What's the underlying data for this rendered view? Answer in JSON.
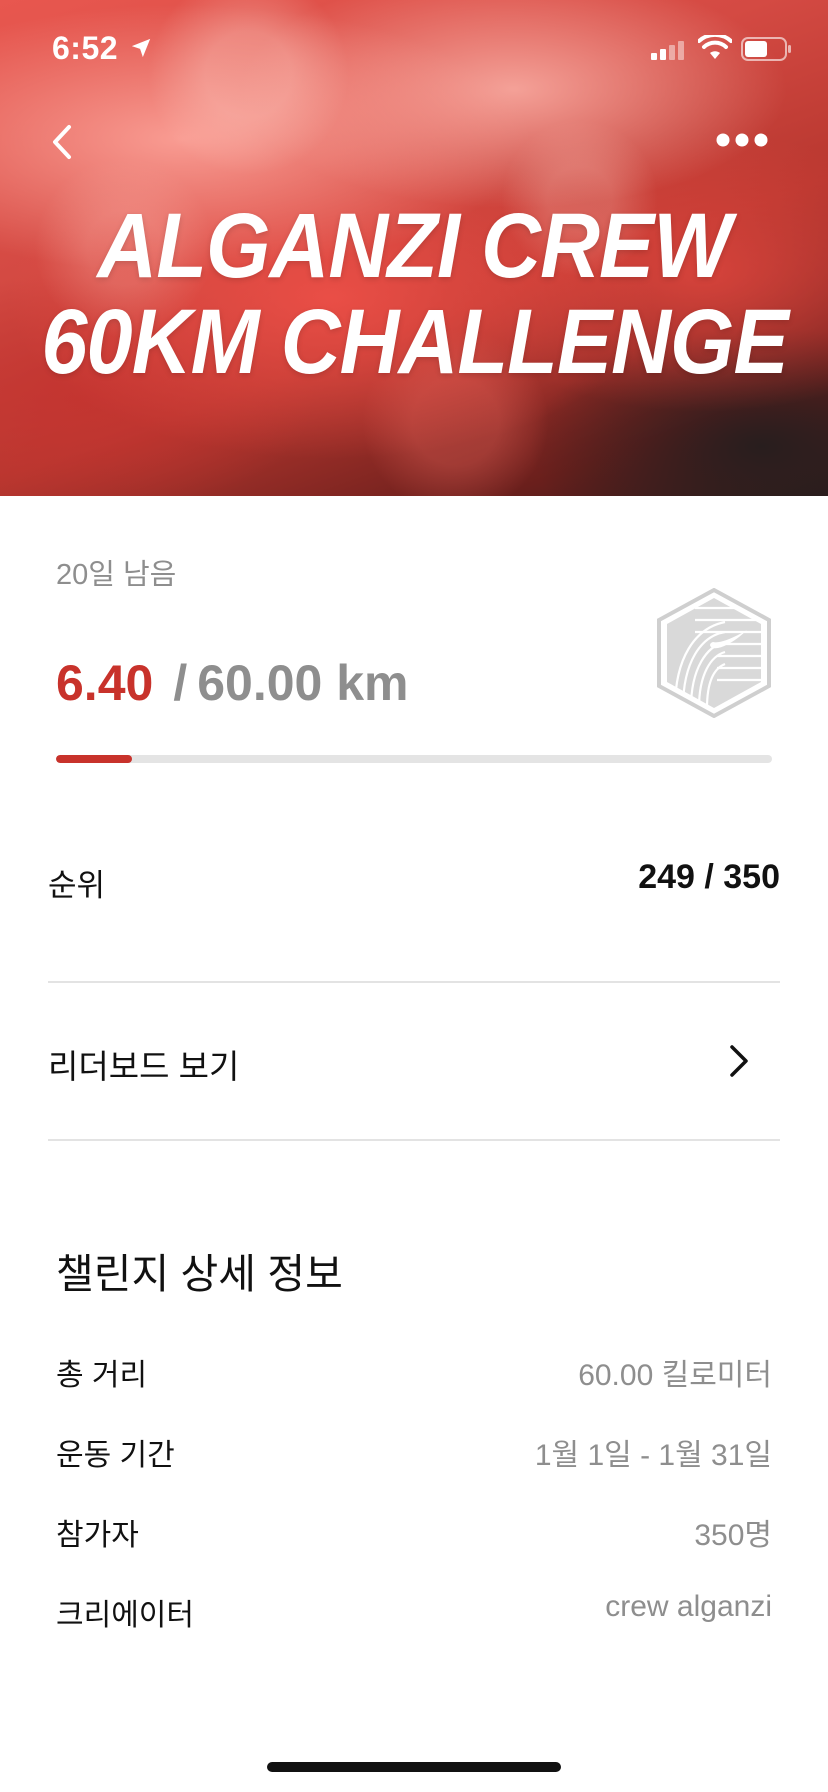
{
  "status_bar": {
    "time": "6:52"
  },
  "hero": {
    "title_line1": "ALGANZI CREW",
    "title_line2": "60KM CHALLENGE"
  },
  "challenge": {
    "days_left": "20일 남음",
    "current_distance": "6.40",
    "separator": "/",
    "total_distance": "60.00 km",
    "progress_fraction": 0.1067,
    "accent_color": "#c8322b"
  },
  "rank": {
    "label": "순위",
    "value": "249 / 350"
  },
  "leaderboard": {
    "label": "리더보드 보기"
  },
  "details": {
    "title": "챌린지 상세 정보",
    "rows": [
      {
        "label": "총 거리",
        "value": "60.00 킬로미터"
      },
      {
        "label": "운동 기간",
        "value": "1월 1일 - 1월 31일"
      },
      {
        "label": "참가자",
        "value": "350명"
      },
      {
        "label": "크리에이터",
        "value": "crew alganzi"
      }
    ]
  },
  "icons": {
    "back": "chevron-left-icon",
    "more": "more-dots-icon",
    "leaderboard": "chevron-right-icon",
    "badge": "nike-challenge-badge-icon"
  }
}
